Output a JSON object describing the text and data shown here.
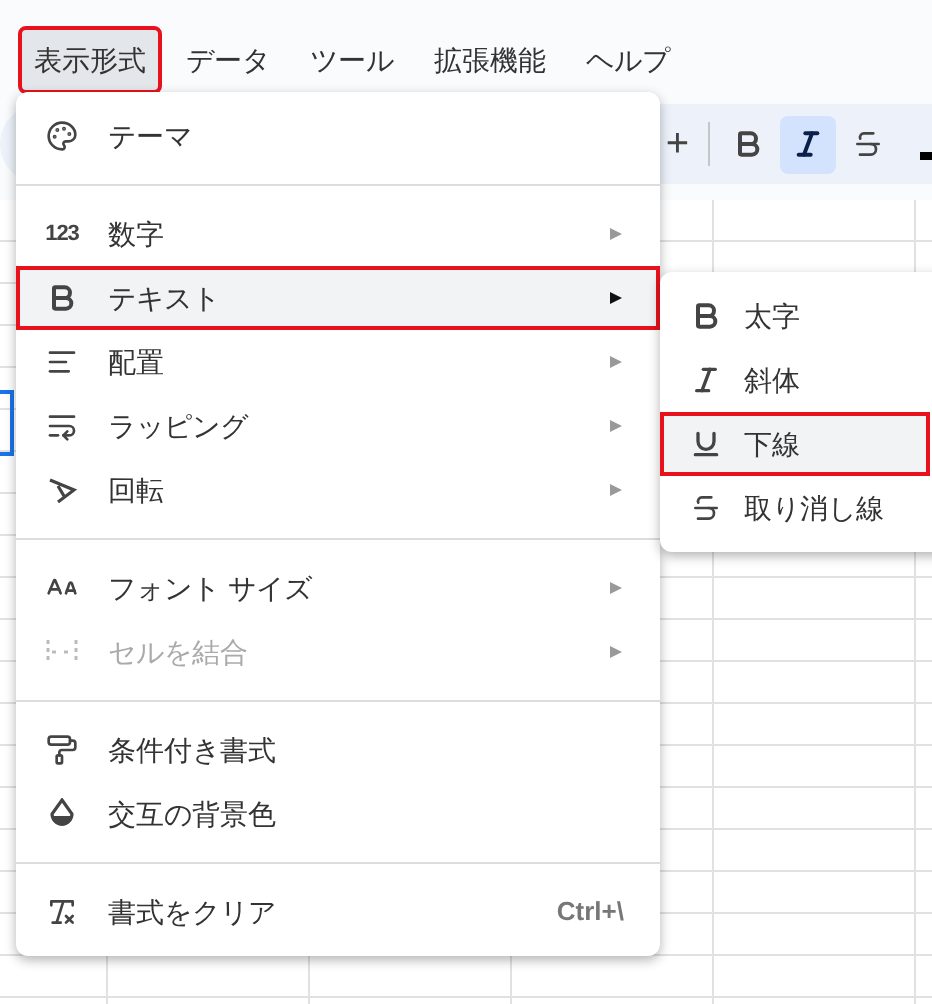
{
  "menu_bar": [
    {
      "label": "表示形式",
      "selected": true,
      "highlighted": true
    },
    {
      "label": "データ",
      "selected": false,
      "highlighted": false
    },
    {
      "label": "ツール",
      "selected": false,
      "highlighted": false
    },
    {
      "label": "拡張機能",
      "selected": false,
      "highlighted": false
    },
    {
      "label": "ヘルプ",
      "selected": false,
      "highlighted": false
    }
  ],
  "toolbar": {
    "plus": "+",
    "buttons": [
      {
        "kind": "bold",
        "selected": false
      },
      {
        "kind": "italic",
        "selected": true
      },
      {
        "kind": "strike",
        "selected": false
      }
    ]
  },
  "format_menu": [
    {
      "kind": "item",
      "label": "テーマ",
      "submenu": false,
      "disabled": false,
      "selected": false,
      "highlighted": false
    },
    {
      "kind": "divider"
    },
    {
      "kind": "item",
      "icon_text": "123",
      "label": "数字",
      "submenu": true,
      "disabled": false,
      "selected": false,
      "highlighted": false
    },
    {
      "kind": "item",
      "label": "テキスト",
      "submenu": true,
      "disabled": false,
      "selected": true,
      "highlighted": true
    },
    {
      "kind": "item",
      "label": "配置",
      "submenu": true,
      "disabled": false,
      "selected": false,
      "highlighted": false
    },
    {
      "kind": "item",
      "label": "ラッピング",
      "submenu": true,
      "disabled": false,
      "selected": false,
      "highlighted": false
    },
    {
      "kind": "item",
      "label": "回転",
      "submenu": true,
      "disabled": false,
      "selected": false,
      "highlighted": false
    },
    {
      "kind": "divider"
    },
    {
      "kind": "item",
      "label": "フォント サイズ",
      "submenu": true,
      "disabled": false,
      "selected": false,
      "highlighted": false
    },
    {
      "kind": "item",
      "label": "セルを結合",
      "submenu": true,
      "disabled": true,
      "selected": false,
      "highlighted": false
    },
    {
      "kind": "divider"
    },
    {
      "kind": "item",
      "label": "条件付き書式",
      "submenu": false,
      "disabled": false,
      "selected": false,
      "highlighted": false
    },
    {
      "kind": "item",
      "label": "交互の背景色",
      "submenu": false,
      "disabled": false,
      "selected": false,
      "highlighted": false
    },
    {
      "kind": "divider"
    },
    {
      "kind": "item",
      "label": "書式をクリア",
      "shortcut": "Ctrl+\\",
      "submenu": false,
      "disabled": false,
      "selected": false,
      "highlighted": false
    }
  ],
  "text_submenu": [
    {
      "label": "太字",
      "selected": false,
      "highlighted": false
    },
    {
      "label": "斜体",
      "selected": false,
      "highlighted": false
    },
    {
      "label": "下線",
      "selected": true,
      "highlighted": true
    },
    {
      "label": "取り消し線",
      "selected": false,
      "highlighted": false
    }
  ]
}
